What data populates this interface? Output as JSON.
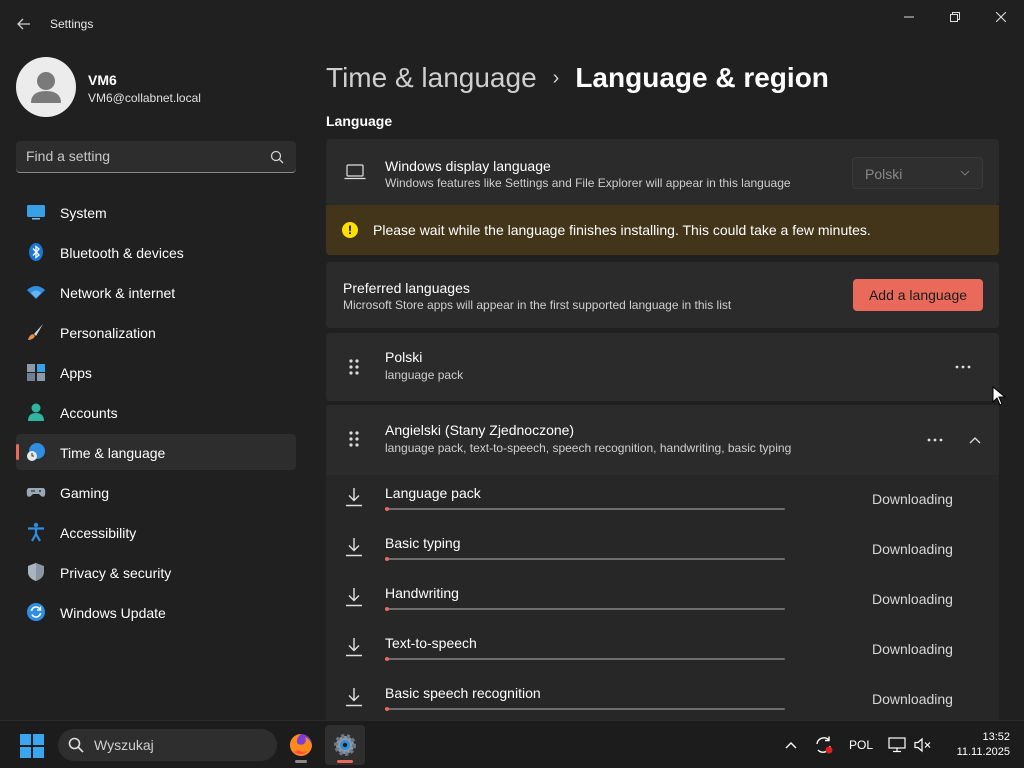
{
  "window": {
    "title": "Settings"
  },
  "profile": {
    "name": "VM6",
    "email": "VM6@collabnet.local"
  },
  "search": {
    "placeholder": "Find a setting"
  },
  "nav": {
    "items": [
      {
        "label": "System",
        "icon": "system-icon"
      },
      {
        "label": "Bluetooth & devices",
        "icon": "bluetooth-icon"
      },
      {
        "label": "Network & internet",
        "icon": "wifi-icon"
      },
      {
        "label": "Personalization",
        "icon": "brush-icon"
      },
      {
        "label": "Apps",
        "icon": "apps-icon"
      },
      {
        "label": "Accounts",
        "icon": "accounts-icon"
      },
      {
        "label": "Time & language",
        "icon": "globe-clock-icon",
        "selected": true
      },
      {
        "label": "Gaming",
        "icon": "gamepad-icon"
      },
      {
        "label": "Accessibility",
        "icon": "accessibility-icon"
      },
      {
        "label": "Privacy & security",
        "icon": "shield-icon"
      },
      {
        "label": "Windows Update",
        "icon": "update-icon"
      }
    ]
  },
  "breadcrumb": {
    "parent": "Time & language",
    "separator": "›",
    "current": "Language & region"
  },
  "language_section": {
    "title": "Language",
    "display_language": {
      "title": "Windows display language",
      "subtitle": "Windows features like Settings and File Explorer will appear in this language",
      "selected": "Polski"
    },
    "warning": {
      "text": "Please wait while the language finishes installing. This could take a few minutes."
    },
    "preferred": {
      "title": "Preferred languages",
      "subtitle": "Microsoft Store apps will appear in the first supported language in this list",
      "add_button": "Add a language"
    },
    "languages": [
      {
        "name": "Polski",
        "details": "language pack"
      },
      {
        "name": "Angielski (Stany Zjednoczone)",
        "details": "language pack, text-to-speech, speech recognition, handwriting, basic typing",
        "features": [
          {
            "name": "Language pack",
            "status": "Downloading",
            "progress": 0.01
          },
          {
            "name": "Basic typing",
            "status": "Downloading",
            "progress": 0.01
          },
          {
            "name": "Handwriting",
            "status": "Downloading",
            "progress": 0.01
          },
          {
            "name": "Text-to-speech",
            "status": "Downloading",
            "progress": 0.01
          },
          {
            "name": "Basic speech recognition",
            "status": "Downloading",
            "progress": 0.01
          }
        ]
      }
    ]
  },
  "taskbar": {
    "search_placeholder": "Wyszukaj",
    "language": "POL",
    "time": "13:52",
    "date": "11.11.2025"
  },
  "colors": {
    "accent": "#e96a5a",
    "warning_bg": "#433519",
    "warning_icon": "#fce100"
  }
}
